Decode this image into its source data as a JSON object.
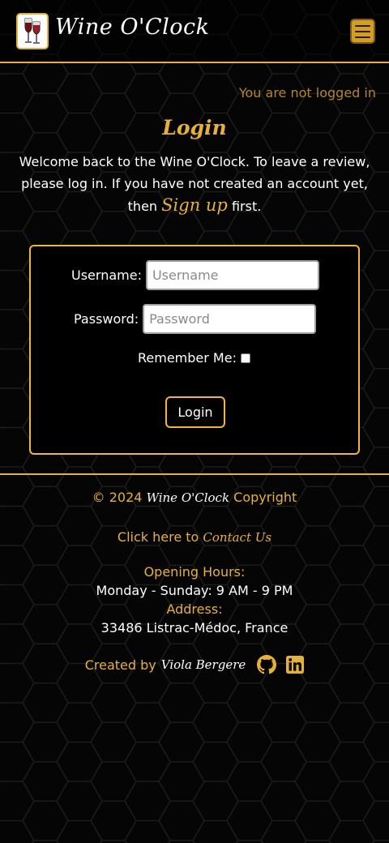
{
  "header": {
    "brand": "Wine O'Clock",
    "logo_icon": "wine-glass-icon",
    "menu_icon": "hamburger-icon"
  },
  "status": {
    "text": "You are not logged in"
  },
  "login": {
    "title": "Login",
    "intro_part1": "Welcome back to the Wine O'Clock. To leave a review, please log in. If you have not created an account yet, then",
    "signup_link": "Sign up",
    "intro_part2": "first."
  },
  "form": {
    "username_label": "Username:",
    "username_placeholder": "Username",
    "username_value": "",
    "password_label": "Password:",
    "password_placeholder": "Password",
    "password_value": "",
    "remember_label": "Remember Me:",
    "remember_checked": false,
    "submit_label": "Login"
  },
  "footer": {
    "copyright_prefix": "© 2024",
    "copyright_brand": "Wine O'Clock",
    "copyright_suffix": "Copyright",
    "contact_prefix": "Click here to",
    "contact_link": "Contact Us",
    "hours_label": "Opening Hours:",
    "hours_value": "Monday - Sunday: 9 AM - 9 PM",
    "address_label": "Address:",
    "address_value": "33486 Listrac-Médoc, France",
    "created_prefix": "Created by",
    "created_name": "Viola Bergere",
    "social": [
      "github-icon",
      "linkedin-icon"
    ]
  },
  "colors": {
    "accent": "#e6b13a",
    "background": "#050505",
    "text": "#ffffff"
  }
}
